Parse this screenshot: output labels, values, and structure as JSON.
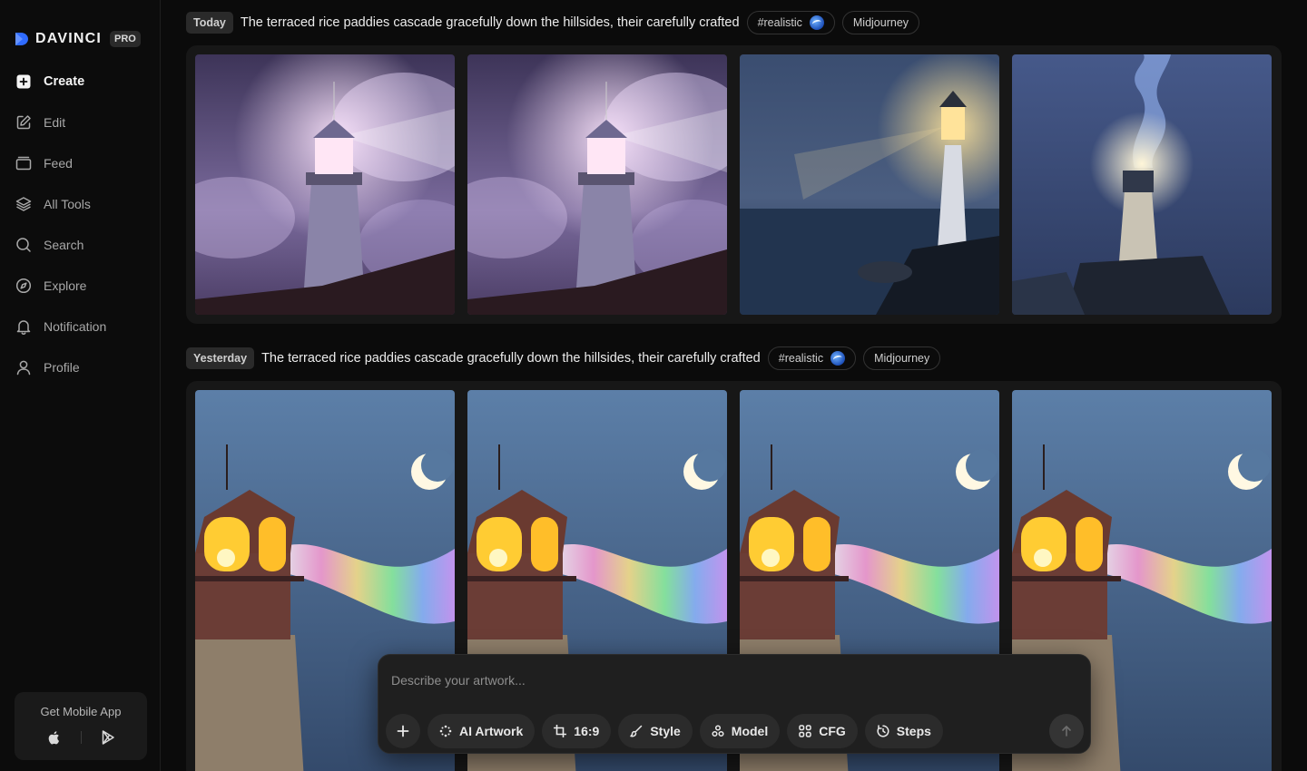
{
  "brand": {
    "name": "DAVINCI",
    "badge": "PRO",
    "accent": "#2f6bff"
  },
  "nav": [
    {
      "label": "Create",
      "icon": "plus-square-icon",
      "active": true
    },
    {
      "label": "Edit",
      "icon": "edit-icon"
    },
    {
      "label": "Feed",
      "icon": "feed-icon"
    },
    {
      "label": "All Tools",
      "icon": "layers-icon"
    },
    {
      "label": "Search",
      "icon": "search-icon"
    },
    {
      "label": "Explore",
      "icon": "compass-icon"
    },
    {
      "label": "Notification",
      "icon": "bell-icon"
    },
    {
      "label": "Profile",
      "icon": "user-icon"
    }
  ],
  "mobile": {
    "title": "Get Mobile App"
  },
  "generations": [
    {
      "day": "Today",
      "prompt": "The terraced rice paddies cascade gracefully down the hillsides, their carefully crafted",
      "tag": "#realistic",
      "model": "Midjourney"
    },
    {
      "day": "Yesterday",
      "prompt": "The terraced rice paddies cascade gracefully down the hillsides, their carefully crafted",
      "tag": "#realistic",
      "model": "Midjourney"
    }
  ],
  "composer": {
    "placeholder": "Describe your artwork...",
    "tools": {
      "artwork": "AI Artwork",
      "ratio": "16:9",
      "style": "Style",
      "model": "Model",
      "cfg": "CFG",
      "steps": "Steps"
    }
  }
}
